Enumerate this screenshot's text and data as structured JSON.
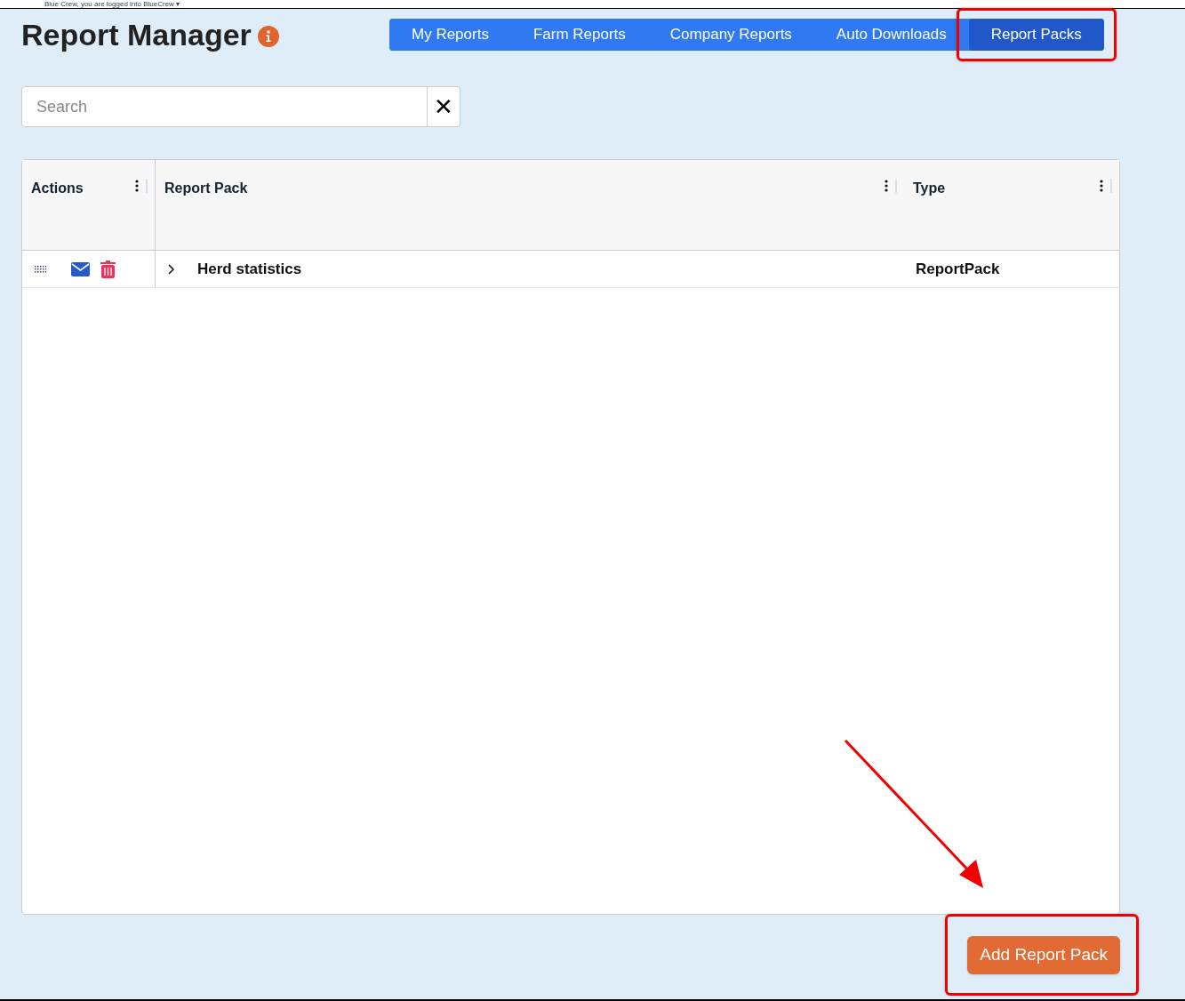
{
  "top_bar": {
    "text": "Blue Crew, you are logged into BlueCrew ▾"
  },
  "header": {
    "title": "Report Manager",
    "info_icon": true
  },
  "tabs": [
    {
      "label": "My Reports",
      "selected": false,
      "highlighted": false
    },
    {
      "label": "Farm Reports",
      "selected": false,
      "highlighted": false
    },
    {
      "label": "Company Reports",
      "selected": false,
      "highlighted": false
    },
    {
      "label": "Auto Downloads",
      "selected": false,
      "highlighted": false
    },
    {
      "label": "Report Packs",
      "selected": true,
      "highlighted": true
    }
  ],
  "search": {
    "placeholder": "Search",
    "clear_label": "✕"
  },
  "table": {
    "columns": [
      "Actions",
      "Report Pack",
      "Type"
    ],
    "rows": [
      {
        "expanded": false,
        "name": "Herd statistics",
        "type": "ReportPack"
      }
    ]
  },
  "add_button": {
    "label": "Add Report Pack",
    "highlighted": true,
    "arrow": true
  }
}
